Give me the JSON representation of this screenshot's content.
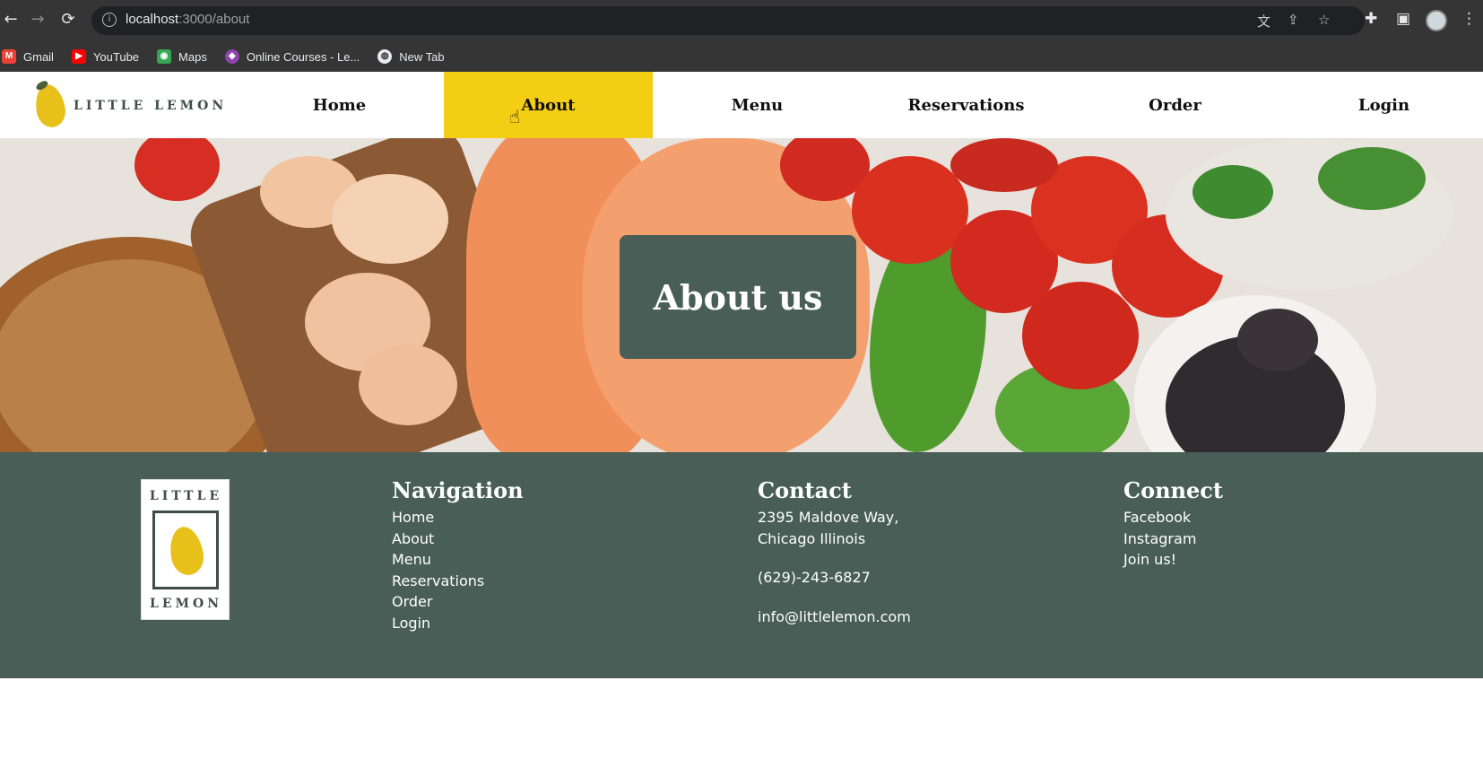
{
  "browser": {
    "url_host": "localhost",
    "url_path": ":3000/about",
    "bookmarks": [
      {
        "label": "Gmail",
        "icon": "gmail-icon",
        "color": "#ea4335"
      },
      {
        "label": "YouTube",
        "icon": "youtube-icon",
        "color": "#ff0000"
      },
      {
        "label": "Maps",
        "icon": "maps-icon",
        "color": "#34a853"
      },
      {
        "label": "Online Courses - Le...",
        "icon": "courses-icon",
        "color": "#8e44ad"
      },
      {
        "label": "New Tab",
        "icon": "globe-icon",
        "color": "#5f6368"
      }
    ]
  },
  "header": {
    "logo_text": "LITTLE LEMON",
    "nav": [
      "Home",
      "About",
      "Menu",
      "Reservations",
      "Order",
      "Login"
    ],
    "active": "About"
  },
  "hero": {
    "title": "About us"
  },
  "footer": {
    "logo_top": "LITTLE",
    "logo_bottom": "LEMON",
    "navigation": {
      "heading": "Navigation",
      "links": [
        "Home",
        "About",
        "Menu",
        "Reservations",
        "Order",
        "Login"
      ]
    },
    "contact": {
      "heading": "Contact",
      "address_line1": "2395 Maldove Way,",
      "address_line2": "Chicago Illinois",
      "phone": "(629)-243-6827",
      "email": "info@littlelemon.com"
    },
    "connect": {
      "heading": "Connect",
      "links": [
        "Facebook",
        "Instagram",
        "Join us!"
      ]
    }
  },
  "colors": {
    "primary_green": "#495e57",
    "primary_yellow": "#f4ce14"
  }
}
